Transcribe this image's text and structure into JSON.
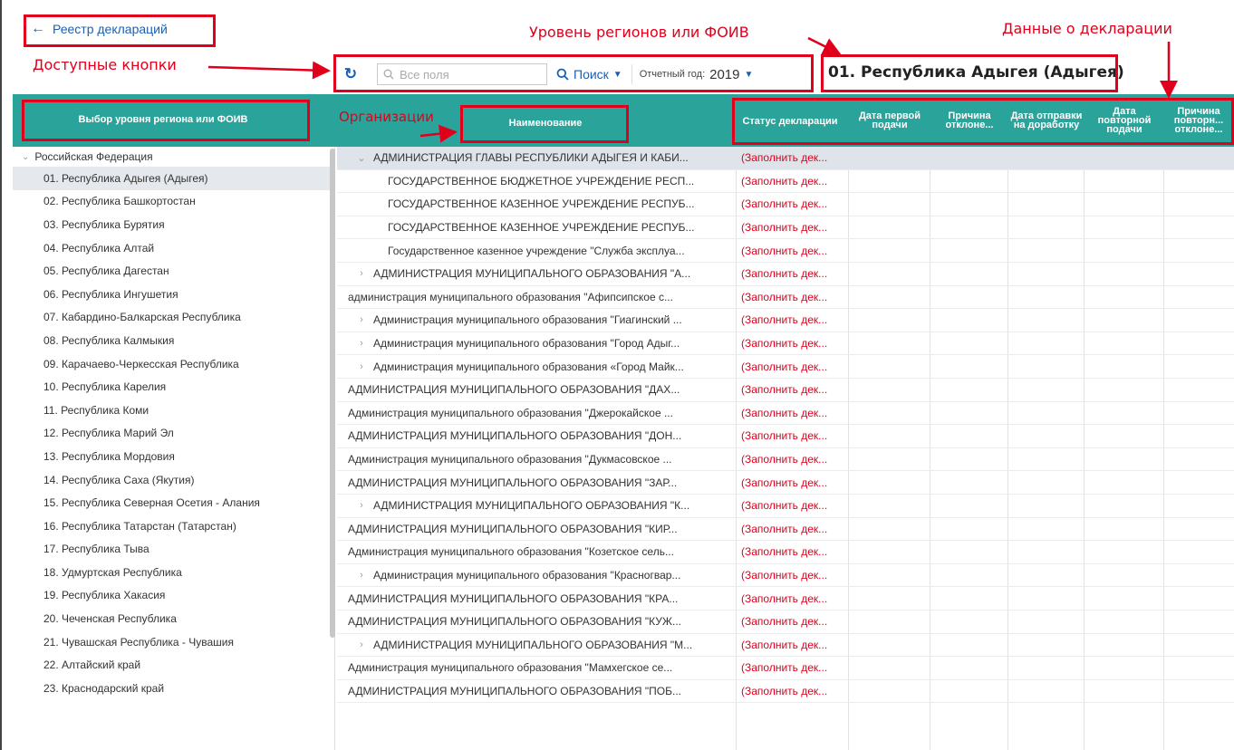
{
  "nav": {
    "back_arrow": "←",
    "back_label": "Реестр деклараций"
  },
  "toolbar": {
    "refresh_icon": "↻",
    "search_placeholder": "Все поля",
    "search_label": "Поиск",
    "year_label": "Отчетный год:",
    "year_value": "2019"
  },
  "region_title": "01. Республика Адыгея (Адыгея)",
  "annotations": {
    "buttons": "Доступные кнопки",
    "regions_level": "Уровень регионов или ФОИВ",
    "declaration_data": "Данные о декларации",
    "organizations": "Организации"
  },
  "left_panel": {
    "header": "Выбор уровня региона или ФОИВ",
    "root": "Российская Федерация",
    "items": [
      "01. Республика Адыгея (Адыгея)",
      "02. Республика Башкортостан",
      "03. Республика Бурятия",
      "04. Республика Алтай",
      "05. Республика Дагестан",
      "06. Республика Ингушетия",
      "07. Кабардино-Балкарская Республика",
      "08. Республика Калмыкия",
      "09. Карачаево-Черкесская Республика",
      "10. Республика Карелия",
      "11. Республика Коми",
      "12. Республика Марий Эл",
      "13. Республика Мордовия",
      "14. Республика Саха (Якутия)",
      "15. Республика Северная Осетия - Алания",
      "16. Республика Татарстан (Татарстан)",
      "17. Республика Тыва",
      "18. Удмуртская Республика",
      "19. Республика Хакасия",
      "20. Чеченская Республика",
      "21. Чувашская Республика - Чувашия",
      "22. Алтайский край",
      "23. Краснодарский край"
    ]
  },
  "grid": {
    "columns": [
      "Наименование",
      "Статус декларации",
      "Дата первой подачи",
      "Причина отклоне...",
      "Дата отправки на доработку",
      "Дата повторной подачи",
      "Причина повторн... отклоне..."
    ],
    "rows": [
      {
        "name": "АДМИНИСТРАЦИЯ ГЛАВЫ РЕСПУБЛИКИ АДЫГЕЯ И КАБИ...",
        "status": "(Заполнить дек...",
        "level": 0,
        "expander": "⌄"
      },
      {
        "name": "ГОСУДАРСТВЕННОЕ БЮДЖЕТНОЕ УЧРЕЖДЕНИЕ РЕСП...",
        "status": "(Заполнить дек...",
        "level": 2,
        "expander": ""
      },
      {
        "name": "ГОСУДАРСТВЕННОЕ КАЗЕННОЕ УЧРЕЖДЕНИЕ РЕСПУБ...",
        "status": "(Заполнить дек...",
        "level": 2,
        "expander": ""
      },
      {
        "name": "ГОСУДАРСТВЕННОЕ КАЗЕННОЕ УЧРЕЖДЕНИЕ РЕСПУБ...",
        "status": "(Заполнить дек...",
        "level": 2,
        "expander": ""
      },
      {
        "name": "Государственное казенное учреждение \"Служба эксплуа...",
        "status": "(Заполнить дек...",
        "level": 2,
        "expander": ""
      },
      {
        "name": "АДМИНИСТРАЦИЯ МУНИЦИПАЛЬНОГО ОБРАЗОВАНИЯ \"А...",
        "status": "(Заполнить дек...",
        "level": 0,
        "expander": "›"
      },
      {
        "name": "администрация муниципального образования \"Афипсипское с...",
        "status": "(Заполнить дек...",
        "level": 1,
        "expander": ""
      },
      {
        "name": "Администрация муниципального образования \"Гиагинский ...",
        "status": "(Заполнить дек...",
        "level": 0,
        "expander": "›"
      },
      {
        "name": "Администрация муниципального образования \"Город Адыг...",
        "status": "(Заполнить дек...",
        "level": 0,
        "expander": "›"
      },
      {
        "name": "Администрация муниципального образования «Город Майк...",
        "status": "(Заполнить дек...",
        "level": 0,
        "expander": "›"
      },
      {
        "name": "АДМИНИСТРАЦИЯ МУНИЦИПАЛЬНОГО ОБРАЗОВАНИЯ \"ДАХ...",
        "status": "(Заполнить дек...",
        "level": 1,
        "expander": ""
      },
      {
        "name": "Администрация муниципального образования \"Джерокайское ...",
        "status": "(Заполнить дек...",
        "level": 1,
        "expander": ""
      },
      {
        "name": "АДМИНИСТРАЦИЯ МУНИЦИПАЛЬНОГО ОБРАЗОВАНИЯ \"ДОН...",
        "status": "(Заполнить дек...",
        "level": 1,
        "expander": ""
      },
      {
        "name": "Администрация муниципального образования \"Дукмасовское ...",
        "status": "(Заполнить дек...",
        "level": 1,
        "expander": ""
      },
      {
        "name": "АДМИНИСТРАЦИЯ МУНИЦИПАЛЬНОГО ОБРАЗОВАНИЯ \"ЗАР...",
        "status": "(Заполнить дек...",
        "level": 1,
        "expander": ""
      },
      {
        "name": "АДМИНИСТРАЦИЯ МУНИЦИПАЛЬНОГО ОБРАЗОВАНИЯ \"К...",
        "status": "(Заполнить дек...",
        "level": 0,
        "expander": "›"
      },
      {
        "name": "АДМИНИСТРАЦИЯ МУНИЦИПАЛЬНОГО ОБРАЗОВАНИЯ \"КИР...",
        "status": "(Заполнить дек...",
        "level": 1,
        "expander": ""
      },
      {
        "name": "Администрация муниципального образования \"Козетское сель...",
        "status": "(Заполнить дек...",
        "level": 1,
        "expander": ""
      },
      {
        "name": "Администрация муниципального образования \"Красногвар...",
        "status": "(Заполнить дек...",
        "level": 0,
        "expander": "›"
      },
      {
        "name": "АДМИНИСТРАЦИЯ МУНИЦИПАЛЬНОГО ОБРАЗОВАНИЯ \"КРА...",
        "status": "(Заполнить дек...",
        "level": 1,
        "expander": ""
      },
      {
        "name": "АДМИНИСТРАЦИЯ МУНИЦИПАЛЬНОГО ОБРАЗОВАНИЯ \"КУЖ...",
        "status": "(Заполнить дек...",
        "level": 1,
        "expander": ""
      },
      {
        "name": "АДМИНИСТРАЦИЯ МУНИЦИПАЛЬНОГО ОБРАЗОВАНИЯ \"М...",
        "status": "(Заполнить дек...",
        "level": 0,
        "expander": "›"
      },
      {
        "name": "Администрация муниципального образования \"Мамхегское се...",
        "status": "(Заполнить дек...",
        "level": 1,
        "expander": ""
      },
      {
        "name": "АДМИНИСТРАЦИЯ МУНИЦИПАЛЬНОГО ОБРАЗОВАНИЯ \"ПОБ...",
        "status": "(Заполнить дек...",
        "level": 1,
        "expander": ""
      }
    ]
  }
}
